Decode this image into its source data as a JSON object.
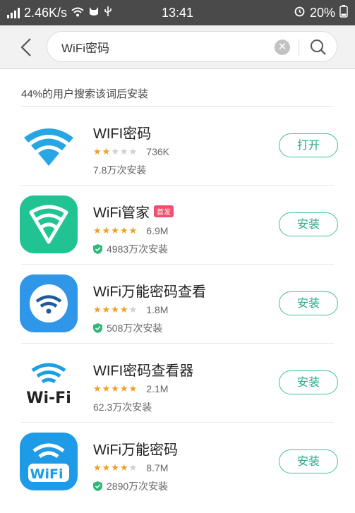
{
  "status_bar": {
    "speed": "2.46K/s",
    "time": "13:41",
    "battery": "20%"
  },
  "search": {
    "query": "WiFi密码"
  },
  "hint": "44%的用户搜索该词后安装",
  "apps": [
    {
      "name": "WIFI密码",
      "badge": "",
      "rating": 1.5,
      "stars": "★★☆☆☆",
      "size": "736K",
      "installs": "7.8万次安装",
      "verified": false,
      "button": "打开",
      "icon": "wifi-signal-icon"
    },
    {
      "name": "WiFi管家",
      "badge": "首发",
      "rating": 4.5,
      "stars": "★★★★★",
      "size": "6.9M",
      "installs": "4983万次安装",
      "verified": true,
      "button": "安装",
      "icon": "wifi-shield-icon"
    },
    {
      "name": "WiFi万能密码查看",
      "badge": "",
      "rating": 3.5,
      "stars": "★★★★☆",
      "size": "1.8M",
      "installs": "508万次安装",
      "verified": true,
      "button": "安装",
      "icon": "wifi-circle-icon"
    },
    {
      "name": "WIFI密码查看器",
      "badge": "",
      "rating": 4.5,
      "stars": "★★★★★",
      "size": "2.1M",
      "installs": "62.3万次安装",
      "verified": false,
      "button": "安装",
      "icon": "wifi-logo-icon"
    },
    {
      "name": "WiFi万能密码",
      "badge": "",
      "rating": 4,
      "stars": "★★★★☆",
      "size": "8.7M",
      "installs": "2890万次安装",
      "verified": true,
      "button": "安装",
      "icon": "wifi-key-icon"
    }
  ],
  "colors": {
    "accent": "#3fbf9f",
    "star": "#f0a020",
    "badge": "#f0506e",
    "status_bar": "#4a4a4a"
  }
}
